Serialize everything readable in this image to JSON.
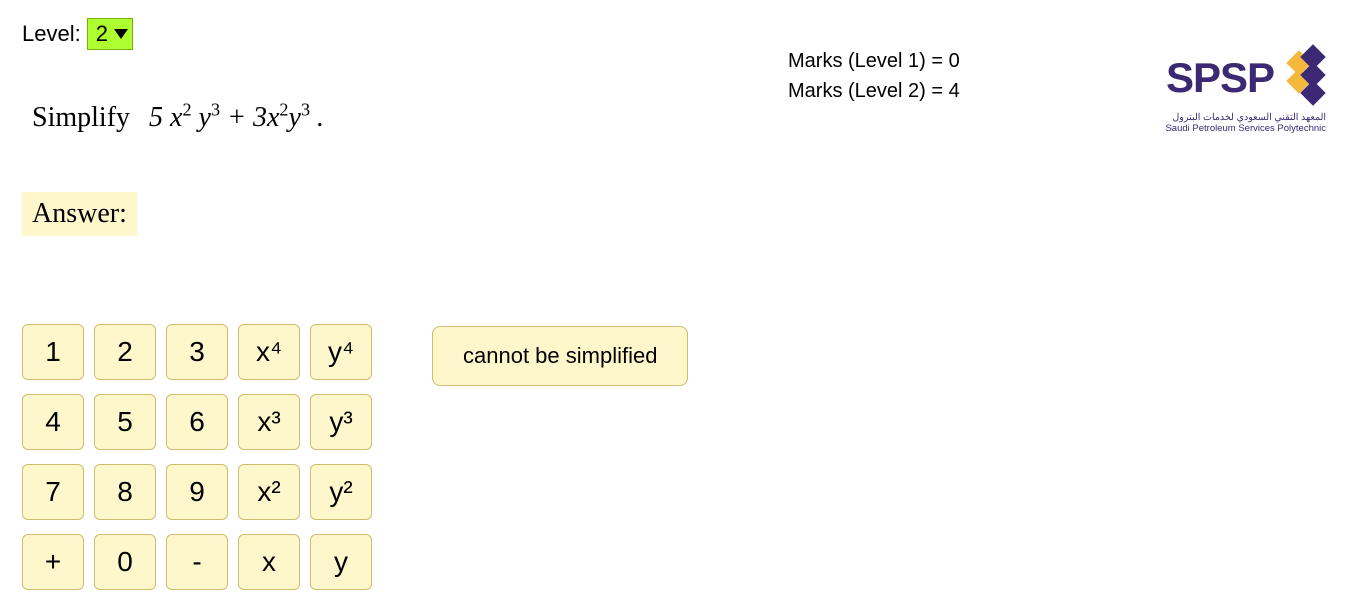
{
  "level": {
    "label": "Level:",
    "value": "2"
  },
  "marks": {
    "l1_text": "Marks (Level 1) = 0",
    "l2_text": "Marks (Level 2) = 4"
  },
  "logo": {
    "brand": "SPSP",
    "sub1": "المعهد التقني السعودي لخدمات البترول",
    "sub2": "Saudi Petroleum Services Polytechnic"
  },
  "question": {
    "prompt": "Simplify",
    "expr_html": "5 <i>x</i><sup>2</sup> <i>y</i><sup>3</sup> + 3<i>x</i><sup>2</sup><i>y</i><sup>3</sup> ."
  },
  "answer_label": "Answer:",
  "keypad": [
    [
      "1",
      "2",
      "3",
      "x⁴",
      "y⁴"
    ],
    [
      "4",
      "5",
      "6",
      "x³",
      "y³"
    ],
    [
      "7",
      "8",
      "9",
      "x²",
      "y²"
    ],
    [
      "+",
      "0",
      "-",
      "x",
      "y"
    ]
  ],
  "cannot_label": "cannot be simplified"
}
